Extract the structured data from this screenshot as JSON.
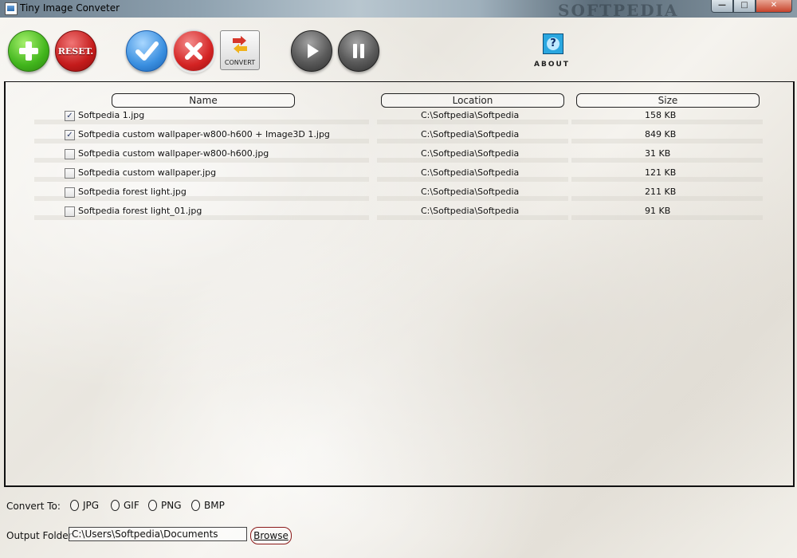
{
  "window": {
    "title": "Tiny Image Conveter",
    "watermark": "SOFTPEDIA",
    "controls": {
      "minimize": "—",
      "maximize": "□",
      "close": "✕"
    }
  },
  "toolbar": {
    "add_icon": "plus-icon",
    "reset_label": "RESET.",
    "check_all_icon": "checkmark-icon",
    "uncheck_all_icon": "x-mark-icon",
    "convert_label": "CONVERT",
    "play_icon": "play-icon",
    "pause_icon": "pause-icon",
    "about_icon": "question-icon",
    "about_question": "?",
    "about_label": "ABOUT"
  },
  "table": {
    "columns": [
      "Name",
      "Location",
      "Size"
    ],
    "rows": [
      {
        "checked": true,
        "check": "✓",
        "name": "Softpedia 1.jpg",
        "location": "C:\\Softpedia\\Softpedia",
        "size": "158 KB"
      },
      {
        "checked": true,
        "check": "✓",
        "name": "Softpedia custom wallpaper-w800-h600 + Image3D 1.jpg",
        "location": "C:\\Softpedia\\Softpedia",
        "size": "849 KB"
      },
      {
        "checked": false,
        "check": "",
        "name": "Softpedia custom wallpaper-w800-h600.jpg",
        "location": "C:\\Softpedia\\Softpedia",
        "size": "31 KB"
      },
      {
        "checked": false,
        "check": "",
        "name": "Softpedia custom wallpaper.jpg",
        "location": "C:\\Softpedia\\Softpedia",
        "size": "121 KB"
      },
      {
        "checked": false,
        "check": "",
        "name": "Softpedia forest light.jpg",
        "location": "C:\\Softpedia\\Softpedia",
        "size": "211 KB"
      },
      {
        "checked": false,
        "check": "",
        "name": "Softpedia forest light_01.jpg",
        "location": "C:\\Softpedia\\Softpedia",
        "size": "91 KB"
      }
    ]
  },
  "convert_to": {
    "label": "Convert To:",
    "options": [
      "JPG",
      "GIF",
      "PNG",
      "BMP"
    ]
  },
  "output": {
    "label": "Output Folder",
    "value": "C:\\Users\\Softpedia\\Documents",
    "browse_label": "Browse"
  }
}
